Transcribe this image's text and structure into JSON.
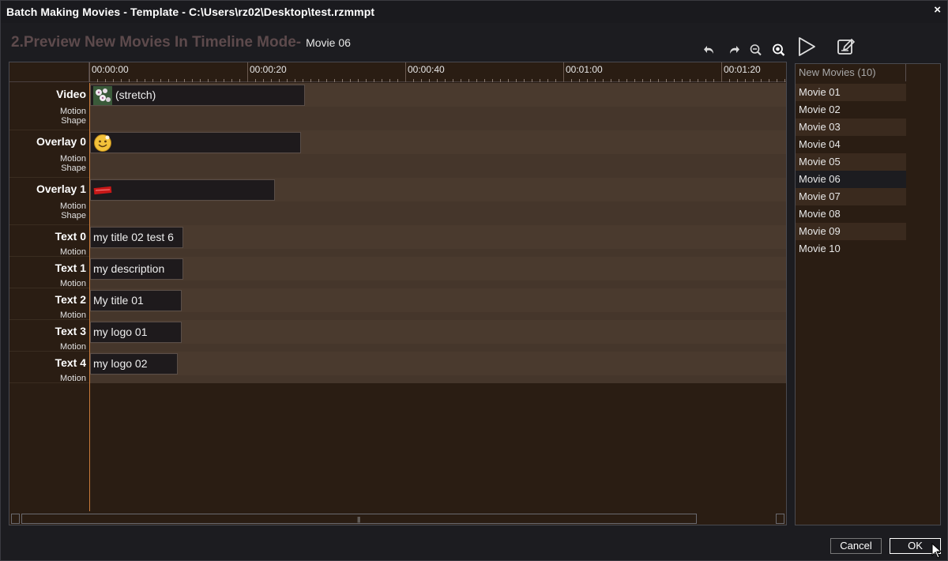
{
  "window": {
    "title": "Batch Making Movies - Template - C:\\Users\\rz02\\Desktop\\test.rzmmpt",
    "close_glyph": "×"
  },
  "heading": {
    "step": "2.Preview New Movies In Timeline Mode-",
    "current_movie": "Movie 06"
  },
  "toolbar": {
    "icons": [
      "undo-icon",
      "redo-icon",
      "zoom-out-icon",
      "zoom-fit-icon",
      "play-icon",
      "edit-icon"
    ]
  },
  "ruler": {
    "labels": [
      "00:00:00",
      "00:00:20",
      "00:00:40",
      "00:01:00",
      "00:01:20"
    ]
  },
  "tracks": [
    {
      "name": "Video",
      "subs": [
        "Motion",
        "Shape"
      ],
      "clip_text": "(stretch)",
      "clip_thumb": "flower-thumbnail"
    },
    {
      "name": "Overlay 0",
      "subs": [
        "Motion",
        "Shape"
      ],
      "clip_text": "",
      "clip_thumb": "smiley-thumbnail"
    },
    {
      "name": "Overlay 1",
      "subs": [
        "Motion",
        "Shape"
      ],
      "clip_text": "",
      "clip_thumb": "red-stamp-thumbnail"
    },
    {
      "name": "Text 0",
      "subs": [
        "Motion"
      ],
      "clip_text": "my title 02 test 6"
    },
    {
      "name": "Text 1",
      "subs": [
        "Motion"
      ],
      "clip_text": "my description"
    },
    {
      "name": "Text 2",
      "subs": [
        "Motion"
      ],
      "clip_text": "My title 01"
    },
    {
      "name": "Text 3",
      "subs": [
        "Motion"
      ],
      "clip_text": "my logo 01"
    },
    {
      "name": "Text 4",
      "subs": [
        "Motion"
      ],
      "clip_text": "my logo 02"
    }
  ],
  "movies": {
    "header": "New Movies (10)",
    "items": [
      "Movie 01",
      "Movie 02",
      "Movie 03",
      "Movie 04",
      "Movie 05",
      "Movie 06",
      "Movie 07",
      "Movie 08",
      "Movie 09",
      "Movie 10"
    ],
    "selected": "Movie 06"
  },
  "buttons": {
    "cancel": "Cancel",
    "ok": "OK"
  },
  "colors": {
    "accent_playhead": "#c87a3a",
    "lane": "#4a3a2e",
    "panel_bg": "#2a1d13"
  }
}
